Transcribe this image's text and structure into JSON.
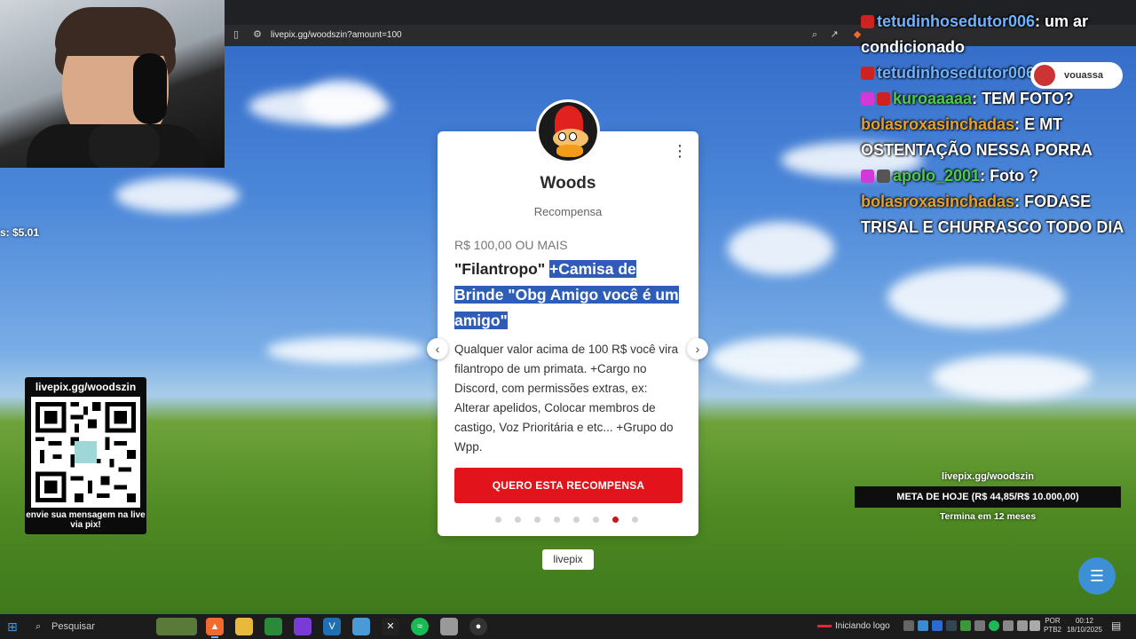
{
  "browser": {
    "url": "livepix.gg/woodszin?amount=100"
  },
  "overlay": {
    "subs_left": "s: $5.01"
  },
  "card": {
    "name": "Woods",
    "subtitle": "Recompensa",
    "price": "R$ 100,00 OU MAIS",
    "title_normal": "\"Filantropo\" ",
    "title_selected": "+Camisa de Brinde \"Obg Amigo você é um amigo\"",
    "description": "Qualquer valor acima de 100 R$ você vira filantropo de um primata. +Cargo no Discord, com permissões extras, ex: Alterar apelidos, Colocar membros de castigo, Voz Prioritária e etc... +Grupo do Wpp.",
    "button_label": "QUERO ESTA RECOMPENSA",
    "dots_total": 8,
    "active_dot": 7,
    "logo_text": "livepix"
  },
  "qr_panel": {
    "title": "livepix.gg/woodszin",
    "footer": "envie sua mensagem na live via pix!"
  },
  "chat": {
    "messages": [
      {
        "user": "tetudinhosedutor006",
        "text": "um ar condicionado",
        "user_color": "#6fb2ff"
      },
      {
        "user": "tetudinhosedutor006",
        "text": "vouassa",
        "user_color": "#6fb2ff"
      },
      {
        "user": "kuroaaaaa",
        "text": "TEM FOTO?",
        "user_color": "#4ec94e"
      },
      {
        "user": "bolasroxasinchadas",
        "text": "E MT OSTENTAÇÃO NESSA PORRA",
        "user_color": "#e6a02c"
      },
      {
        "user": "apolo_2001",
        "text": "Foto ?",
        "user_color": "#4ec94e"
      },
      {
        "user": "bolasroxasinchadas",
        "text": "FODASE TRISAL E CHURRASCO TODO DIA",
        "user_color": "#e6a02c"
      }
    ],
    "pill_text": "vouassa"
  },
  "goal": {
    "host": "livepix.gg/woodszin",
    "bar_text": "META DE HOJE (R$ 44,85/R$ 10.000,00)",
    "ends": "Termina em 12 meses"
  },
  "taskbar": {
    "search_placeholder": "Pesquisar",
    "stream_status": "Iniciando logo",
    "lang_line1": "POR",
    "lang_line2": "PTB2",
    "time": "00:12",
    "date": "18/10/2025"
  },
  "colors": {
    "accent_red": "#e2131b",
    "selection_blue": "#2f5cb6",
    "chat_fab": "#3d8fd6"
  }
}
